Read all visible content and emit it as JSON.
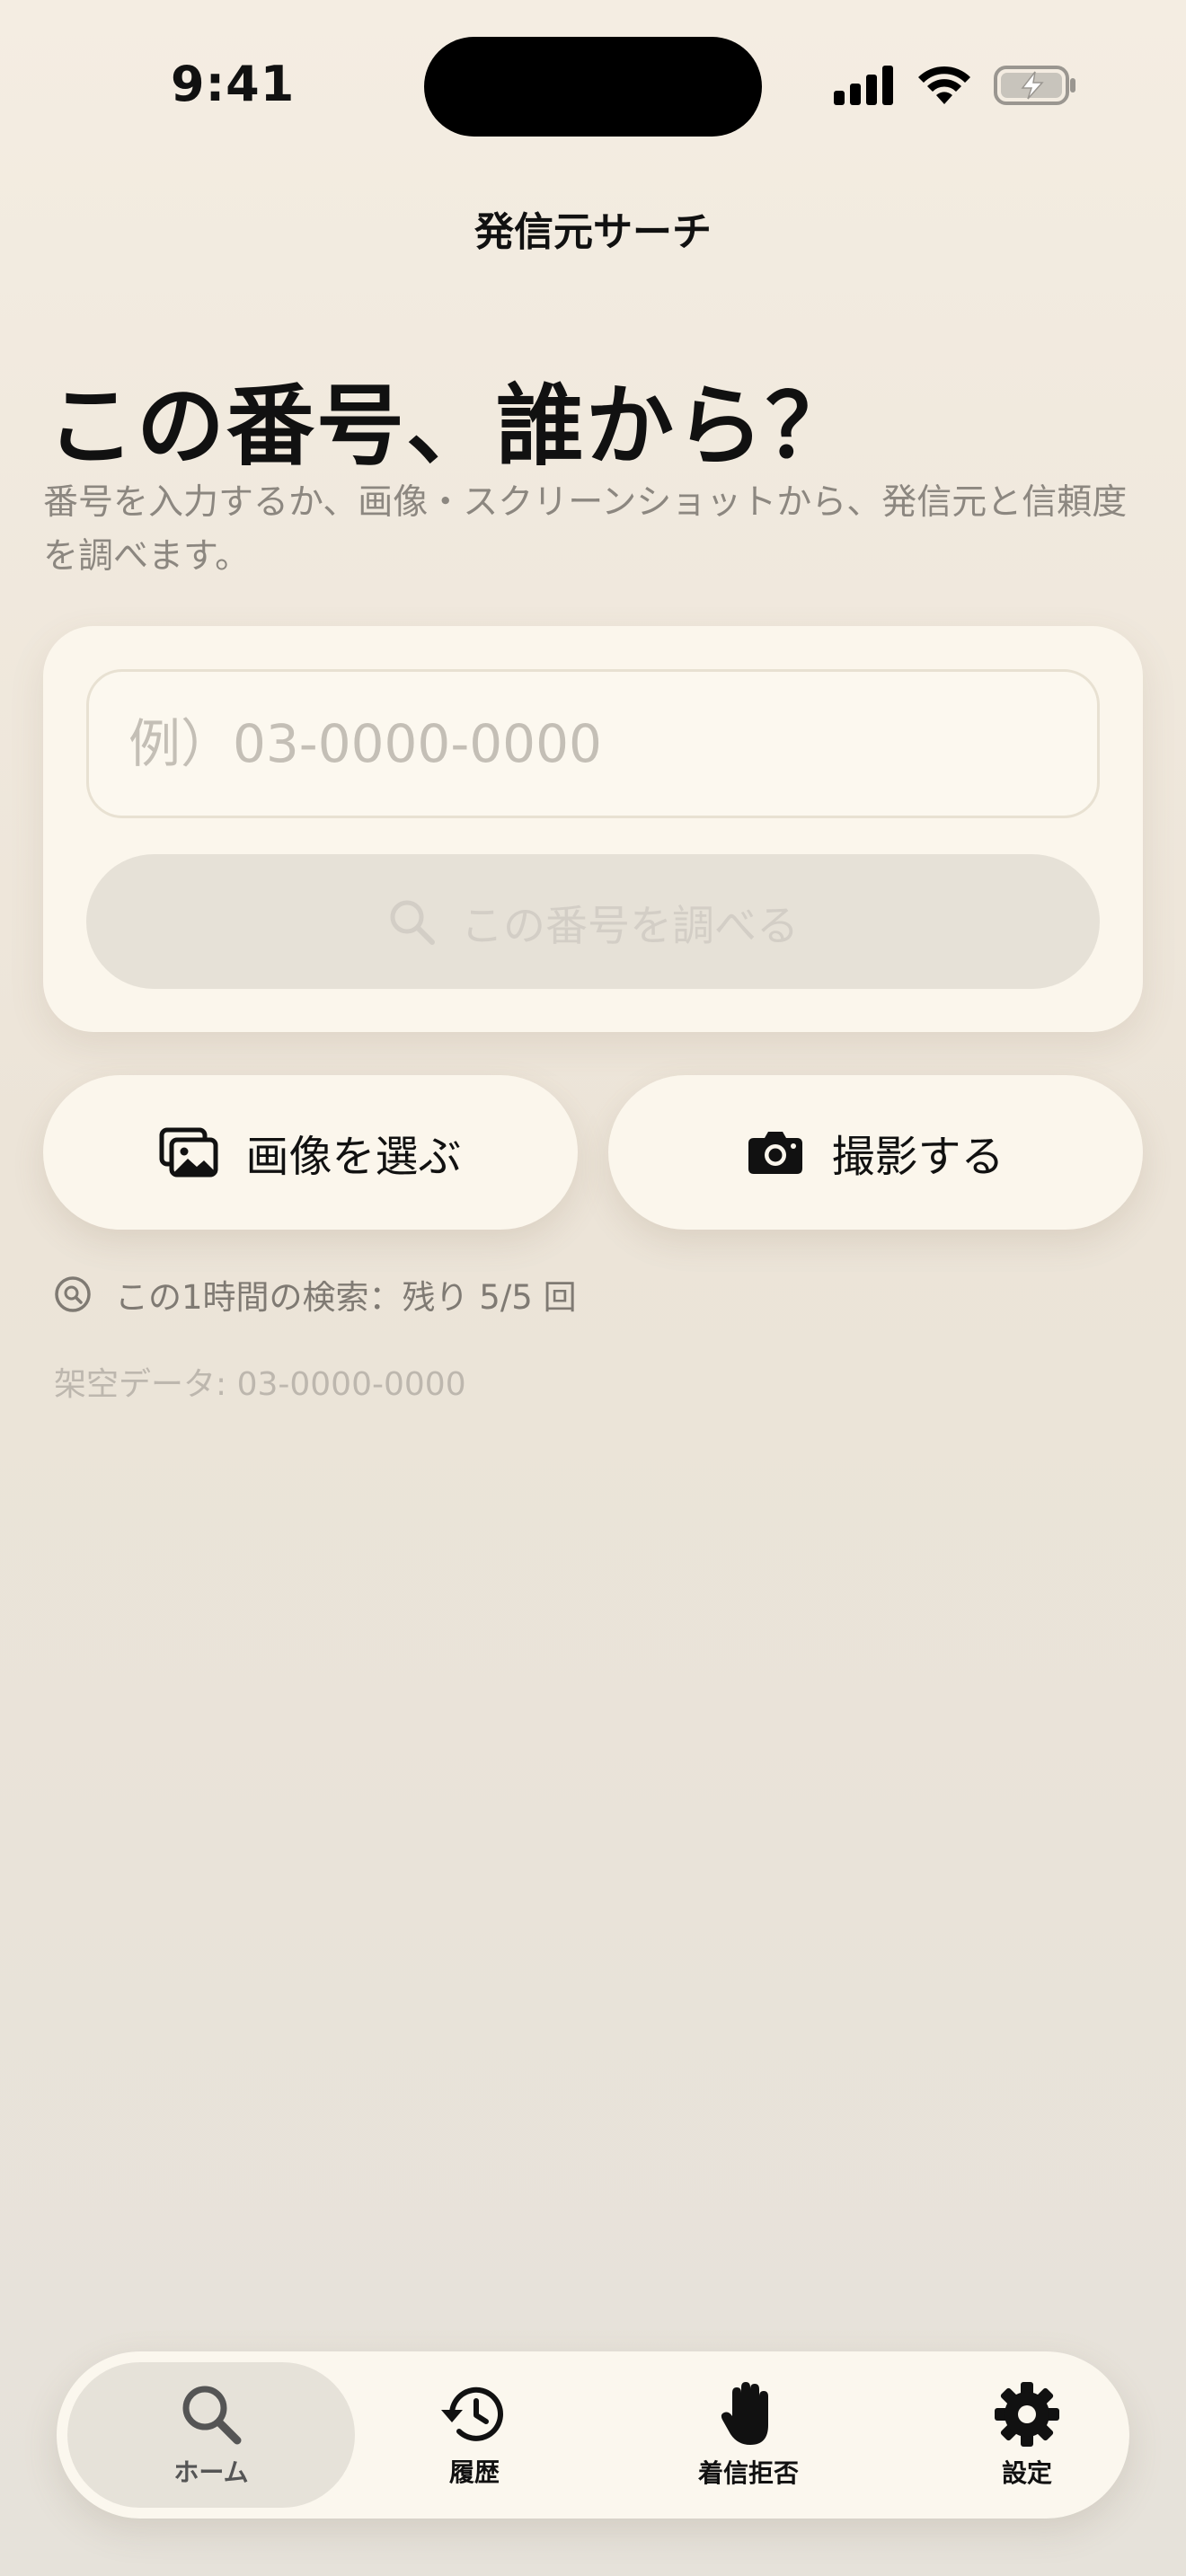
{
  "status_bar": {
    "time": "9:41"
  },
  "nav": {
    "title": "発信元サーチ"
  },
  "hero": {
    "headline": "この番号、誰から？",
    "subtitle": "番号を入力するか、画像・スクリーンショットから、発信元と信頼度を調べます。"
  },
  "search": {
    "placeholder": "例）03-0000-0000",
    "value": "",
    "button_label": "この番号を調べる"
  },
  "actions": {
    "pick_image_label": "画像を選ぶ",
    "take_photo_label": "撮影する"
  },
  "quota": {
    "text": "この1時間の検索：残り 5/5 回"
  },
  "sample": {
    "text": "架空データ: 03-0000-0000"
  },
  "tabs": [
    {
      "label": "ホーム",
      "icon": "search-icon",
      "active": true
    },
    {
      "label": "履歴",
      "icon": "history-icon",
      "active": false
    },
    {
      "label": "着信拒否",
      "icon": "hand-icon",
      "active": false
    },
    {
      "label": "設定",
      "icon": "gear-icon",
      "active": false
    }
  ],
  "colors": {
    "background": "#f4ede2",
    "card": "#fbf6ec",
    "disabled_button": "#e6e1d7",
    "muted_text": "#8c8780"
  }
}
